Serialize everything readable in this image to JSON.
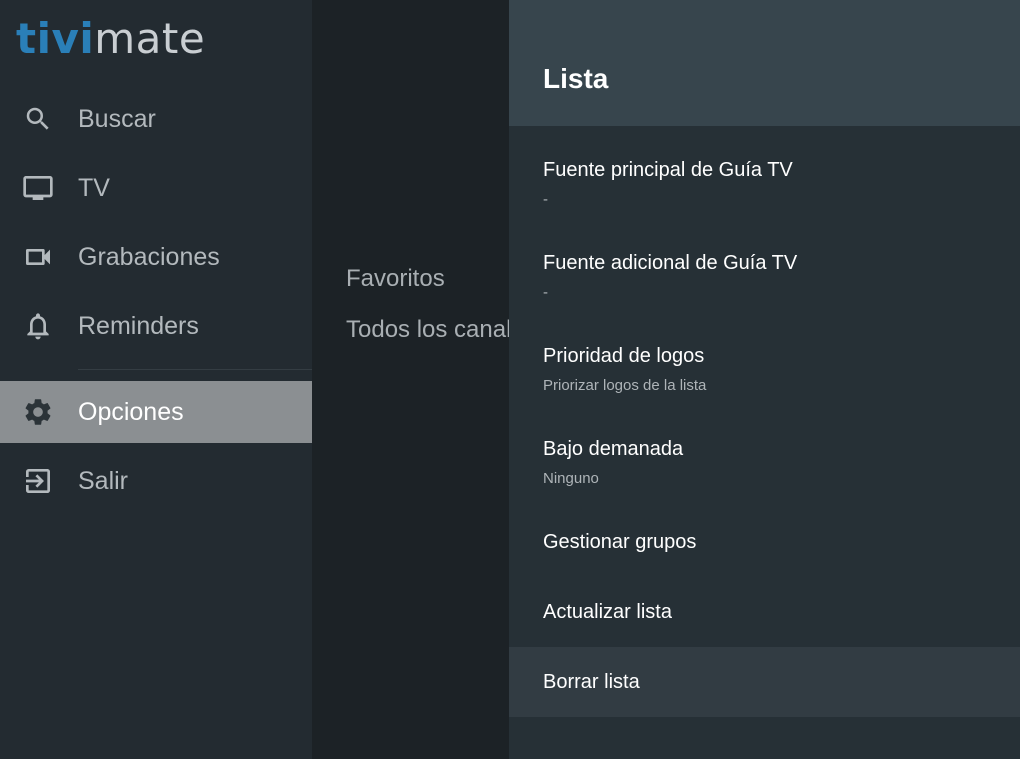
{
  "logo": {
    "part1": "tivi",
    "part2": "mate"
  },
  "sidebar": {
    "items": [
      {
        "label": "Buscar",
        "icon": "search-icon"
      },
      {
        "label": "TV",
        "icon": "tv-icon"
      },
      {
        "label": "Grabaciones",
        "icon": "video-camera-icon"
      },
      {
        "label": "Reminders",
        "icon": "bell-icon"
      },
      {
        "label": "Opciones",
        "icon": "gear-icon",
        "selected": true
      },
      {
        "label": "Salir",
        "icon": "exit-icon"
      }
    ]
  },
  "groups": [
    "Favoritos",
    "Todos los canales"
  ],
  "panel": {
    "title": "Lista",
    "options": [
      {
        "title": "Fuente principal de Guía TV",
        "subtitle": "-"
      },
      {
        "title": "Fuente adicional de Guía TV",
        "subtitle": "-"
      },
      {
        "title": "Prioridad de logos",
        "subtitle": "Priorizar logos de la lista"
      },
      {
        "title": "Bajo demanada",
        "subtitle": "Ninguno"
      },
      {
        "title": "Gestionar grupos"
      },
      {
        "title": "Actualizar lista"
      },
      {
        "title": "Borrar lista",
        "focused": true
      }
    ]
  },
  "colors": {
    "sidebar_bg": "#232b31",
    "selected_bg": "#8b8f92",
    "panel_bg": "#263036",
    "panel_header_bg": "#37454d",
    "logo_accent": "#2a7fb8"
  }
}
